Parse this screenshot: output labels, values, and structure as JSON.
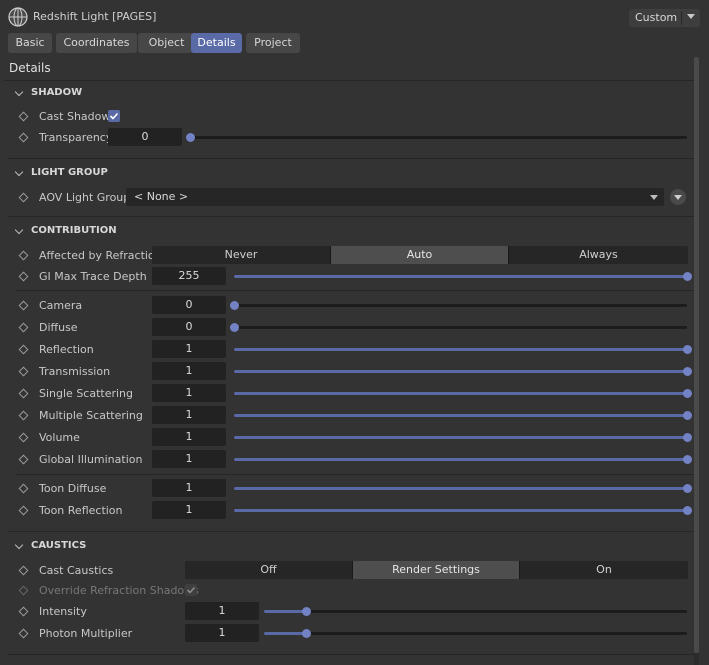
{
  "window": {
    "title": "Redshift Light [PAGES]",
    "icon": "globe-icon",
    "preset": "Custom"
  },
  "tabs": [
    {
      "label": "Basic",
      "active": false
    },
    {
      "label": "Coordinates",
      "active": false
    },
    {
      "label": "Object",
      "active": false
    },
    {
      "label": "Details",
      "active": true
    },
    {
      "label": "Project",
      "active": false
    }
  ],
  "section": "Details",
  "accent_color": "#5a6aa6",
  "shadow": {
    "title": "SHADOW",
    "cast_shadow": {
      "label": "Cast Shadow",
      "checked": true
    },
    "transparency": {
      "label": "Transparency",
      "value": "0",
      "fraction": 0
    }
  },
  "light_group": {
    "title": "LIGHT GROUP",
    "aov_light_group": {
      "label": "AOV Light Group",
      "value": "< None >"
    }
  },
  "contribution": {
    "title": "CONTRIBUTION",
    "affected_by_refraction": {
      "label": "Affected by Refraction",
      "options": [
        "Never",
        "Auto",
        "Always"
      ],
      "selected": 1
    },
    "gi_max_trace_depth": {
      "label": "GI Max Trace Depth",
      "value": "255",
      "fraction": 1
    },
    "rows": [
      {
        "label": "Camera",
        "value": "0",
        "fraction": 0
      },
      {
        "label": "Diffuse",
        "value": "0",
        "fraction": 0
      },
      {
        "label": "Reflection",
        "value": "1",
        "fraction": 1
      },
      {
        "label": "Transmission",
        "value": "1",
        "fraction": 1
      },
      {
        "label": "Single Scattering",
        "value": "1",
        "fraction": 1
      },
      {
        "label": "Multiple Scattering",
        "value": "1",
        "fraction": 1
      },
      {
        "label": "Volume",
        "value": "1",
        "fraction": 1
      },
      {
        "label": "Global Illumination",
        "value": "1",
        "fraction": 1
      }
    ],
    "toon_rows": [
      {
        "label": "Toon Diffuse",
        "value": "1",
        "fraction": 1
      },
      {
        "label": "Toon Reflection",
        "value": "1",
        "fraction": 1
      }
    ]
  },
  "caustics": {
    "title": "CAUSTICS",
    "cast_caustics": {
      "label": "Cast Caustics",
      "options": [
        "Off",
        "Render Settings",
        "On"
      ],
      "selected": 1
    },
    "override_refraction_shadows": {
      "label": "Override Refraction Shadows",
      "checked": true,
      "disabled": true
    },
    "intensity": {
      "label": "Intensity",
      "value": "1",
      "fraction": 0.1
    },
    "photon_multiplier": {
      "label": "Photon Multiplier",
      "value": "1",
      "fraction": 0.1
    }
  }
}
